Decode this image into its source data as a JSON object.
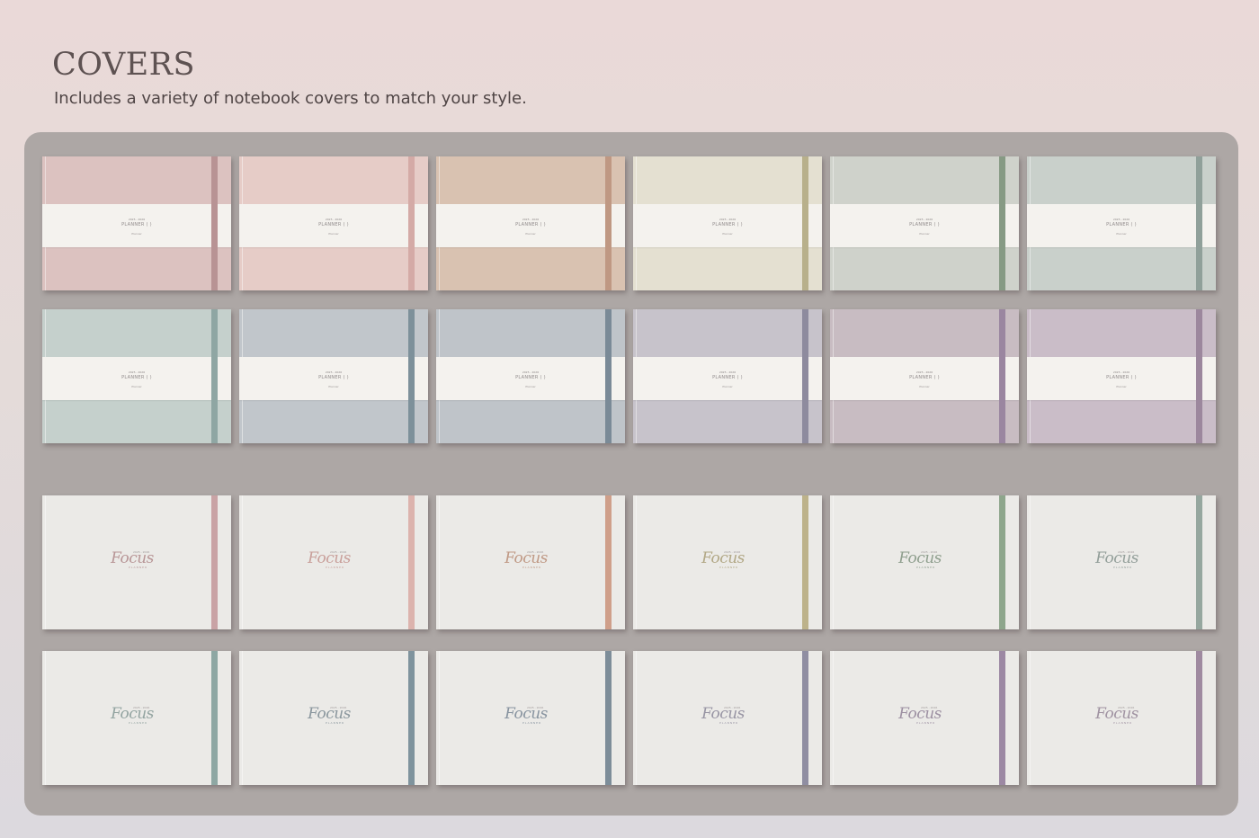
{
  "header": {
    "title": "COVERS",
    "subtitle": "Includes a variety of notebook covers to match your style."
  },
  "band_cover": {
    "years": "2025 - 2026",
    "title": "PLANNER ( )",
    "brand": "Planner"
  },
  "focus_cover": {
    "years": "2025 - 2026",
    "word": "Focus",
    "subtitle": "PLANNER"
  },
  "colors": {
    "panel": "#ada7a5",
    "plain_cover": "#ebeae7",
    "band": "#f4f2ee"
  },
  "band_covers": [
    {
      "name": "dusty-rose",
      "cover": "#dcc2c0",
      "strap": "#b89394"
    },
    {
      "name": "blush",
      "cover": "#e6ccc7",
      "strap": "#d4aaa6"
    },
    {
      "name": "sand",
      "cover": "#d9c2b1",
      "strap": "#bf9883"
    },
    {
      "name": "cream",
      "cover": "#e4e0d1",
      "strap": "#b8b08b"
    },
    {
      "name": "sage",
      "cover": "#cfd2cb",
      "strap": "#869a84"
    },
    {
      "name": "mist-green",
      "cover": "#c9d0cb",
      "strap": "#90a09a"
    },
    {
      "name": "sea-mist",
      "cover": "#c5d0cc",
      "strap": "#8fa6a3"
    },
    {
      "name": "blue-grey",
      "cover": "#c1c6cb",
      "strap": "#7d909a"
    },
    {
      "name": "slate",
      "cover": "#bfc4c9",
      "strap": "#7a8a97"
    },
    {
      "name": "lavender-grey",
      "cover": "#c7c3cb",
      "strap": "#8e8b9e"
    },
    {
      "name": "mauve",
      "cover": "#c8bcc2",
      "strap": "#9a86a0"
    },
    {
      "name": "lilac",
      "cover": "#cabdc8",
      "strap": "#9c879d"
    }
  ],
  "focus_covers": [
    {
      "name": "focus-rose",
      "strap": "#c9a3a5",
      "accent": "#b89697"
    },
    {
      "name": "focus-blush",
      "strap": "#dcb3ad",
      "accent": "#c9a09b"
    },
    {
      "name": "focus-sand",
      "strap": "#cf9f8a",
      "accent": "#c09a86"
    },
    {
      "name": "focus-cream",
      "strap": "#bdb28a",
      "accent": "#b2a886"
    },
    {
      "name": "focus-sage",
      "strap": "#8ea68c",
      "accent": "#8f9f8e"
    },
    {
      "name": "focus-mist",
      "strap": "#96a79f",
      "accent": "#939f9a"
    },
    {
      "name": "focus-sea",
      "strap": "#8ea7a3",
      "accent": "#93a4a1"
    },
    {
      "name": "focus-blue-grey",
      "strap": "#7f939d",
      "accent": "#8b979e"
    },
    {
      "name": "focus-slate",
      "strap": "#7d8d99",
      "accent": "#8894a0"
    },
    {
      "name": "focus-lavender",
      "strap": "#908ea2",
      "accent": "#9895a4"
    },
    {
      "name": "focus-mauve",
      "strap": "#9c88a3",
      "accent": "#9d90a2"
    },
    {
      "name": "focus-lilac",
      "strap": "#9f8aa0",
      "accent": "#a093a2"
    }
  ]
}
